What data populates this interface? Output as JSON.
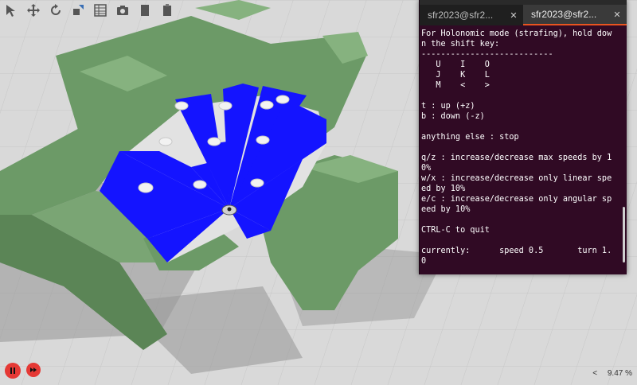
{
  "toolbar": {
    "tools": [
      "select-arrow-icon",
      "translate-icon",
      "rotate-icon",
      "scale-icon",
      "grid-icon",
      "camera-icon",
      "copy-icon",
      "paste-icon"
    ]
  },
  "terminal": {
    "tabs": [
      {
        "label": "sfr2023@sfr2..."
      },
      {
        "label": "sfr2023@sfr2..."
      }
    ],
    "lines": [
      "For Holonomic mode (strafing), hold dow",
      "n the shift key:",
      "---------------------------",
      "   U    I    O",
      "   J    K    L",
      "   M    <    >",
      "",
      "t : up (+z)",
      "b : down (-z)",
      "",
      "anything else : stop",
      "",
      "q/z : increase/decrease max speeds by 1",
      "0%",
      "w/x : increase/decrease only linear spe",
      "ed by 10%",
      "e/c : increase/decrease only angular sp",
      "eed by 10%",
      "",
      "CTRL-C to quit",
      "",
      "currently:      speed 0.5       turn 1.",
      "0"
    ]
  },
  "status": {
    "zoom": "9.47 %",
    "arrow": "<"
  },
  "colors": {
    "terminal_bg": "#300a24",
    "walls": "#6e9966",
    "laser": "#1010ff",
    "play_button": "#e53935"
  }
}
